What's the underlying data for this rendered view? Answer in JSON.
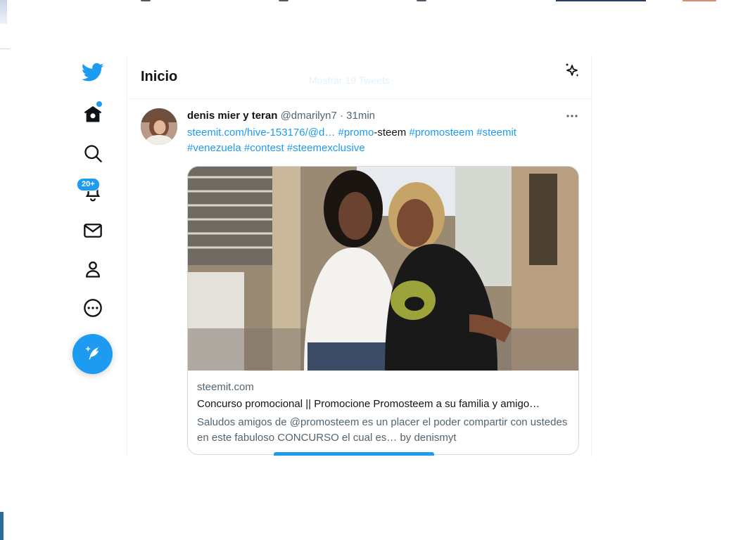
{
  "colors": {
    "accent": "#1d9bf0",
    "text": "#0f1419",
    "secondary": "#536471",
    "border": "#eff3f4"
  },
  "sidebar": {
    "logo_icon": "twitter-bird-icon",
    "items": [
      {
        "icon": "home-icon",
        "has_dot": true
      },
      {
        "icon": "search-icon"
      },
      {
        "icon": "bell-icon",
        "badge": "20+"
      },
      {
        "icon": "mail-icon"
      },
      {
        "icon": "profile-icon"
      },
      {
        "icon": "more-circle-icon"
      }
    ],
    "compose_icon": "compose-tweet-icon"
  },
  "header": {
    "title": "Inicio",
    "ghost_text": "Mostrar 19 Tweets",
    "sparkle_icon": "sparkle-icon"
  },
  "tweet": {
    "name": "denis mier y teran",
    "handle": "@dmarilyn7",
    "sep": "·",
    "time": "31min",
    "text": {
      "link1": "steemit.com/hive-153176/@d…",
      "tag_promo": "#promo",
      "plain_steem": "-steem",
      "tag_promosteem": "#promosteem",
      "tag_steemit": "#steemit",
      "tag_venezuela": "#venezuela",
      "tag_contest": "#contest",
      "tag_steemexclusive": "#steemexclusive"
    },
    "card": {
      "domain": "steemit.com",
      "title": "Concurso promocional || Promocione Promosteem a su familia y amigo…",
      "description": "Saludos amigos de @promosteem es un placer el poder compartir con ustedes en este fabuloso CONCURSO el cual es… by denismyt"
    }
  }
}
